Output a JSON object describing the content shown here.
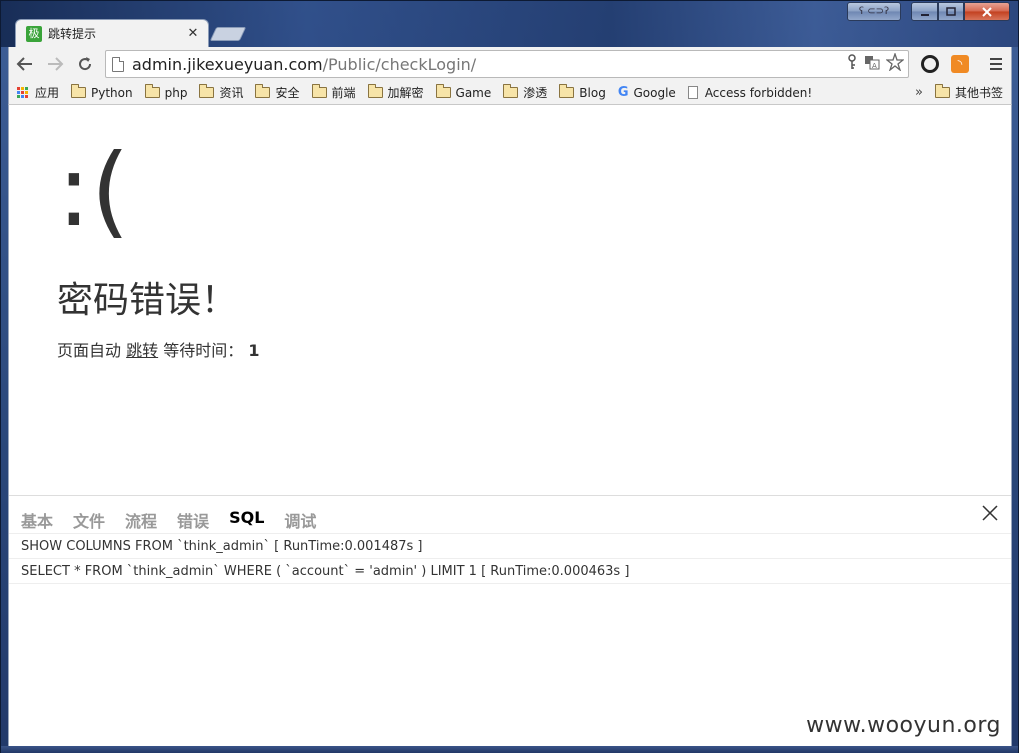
{
  "window": {
    "tab_title": "跳转提示",
    "tab_favicon_text": "极",
    "tab_favicon_color": "#3aa43a",
    "user_button": "ʕ ⊂⊃ʔ"
  },
  "toolbar": {
    "url_host": "admin.jikexueyuan.com",
    "url_path": "/Public/checkLogin/"
  },
  "bookmarks": {
    "apps_label": "应用",
    "items": [
      {
        "label": "Python",
        "icon": "folder-icon"
      },
      {
        "label": "php",
        "icon": "folder-icon"
      },
      {
        "label": "资讯",
        "icon": "folder-icon"
      },
      {
        "label": "安全",
        "icon": "folder-icon"
      },
      {
        "label": "前端",
        "icon": "folder-icon"
      },
      {
        "label": "加解密",
        "icon": "folder-icon"
      },
      {
        "label": "Game",
        "icon": "folder-icon"
      },
      {
        "label": "渗透",
        "icon": "folder-icon"
      },
      {
        "label": "Blog",
        "icon": "folder-icon"
      },
      {
        "label": "Google",
        "icon": "google-icon"
      },
      {
        "label": "Access forbidden!",
        "icon": "page-icon"
      }
    ],
    "more": "»",
    "other_label": "其他书签"
  },
  "page": {
    "sad_face": ":(",
    "error_message": "密码错误！",
    "jump_prefix": "页面自动",
    "jump_link": "跳转",
    "wait_label": "等待时间：",
    "wait_value": "1"
  },
  "trace": {
    "tabs": [
      "基本",
      "文件",
      "流程",
      "错误",
      "SQL",
      "调试"
    ],
    "active_tab": "SQL",
    "rows": [
      "SHOW COLUMNS FROM `think_admin` [ RunTime:0.001487s ]",
      "SELECT * FROM `think_admin` WHERE ( `account` = 'admin' ) LIMIT 1 [ RunTime:0.000463s ]"
    ]
  },
  "watermark": "www.wooyun.org"
}
